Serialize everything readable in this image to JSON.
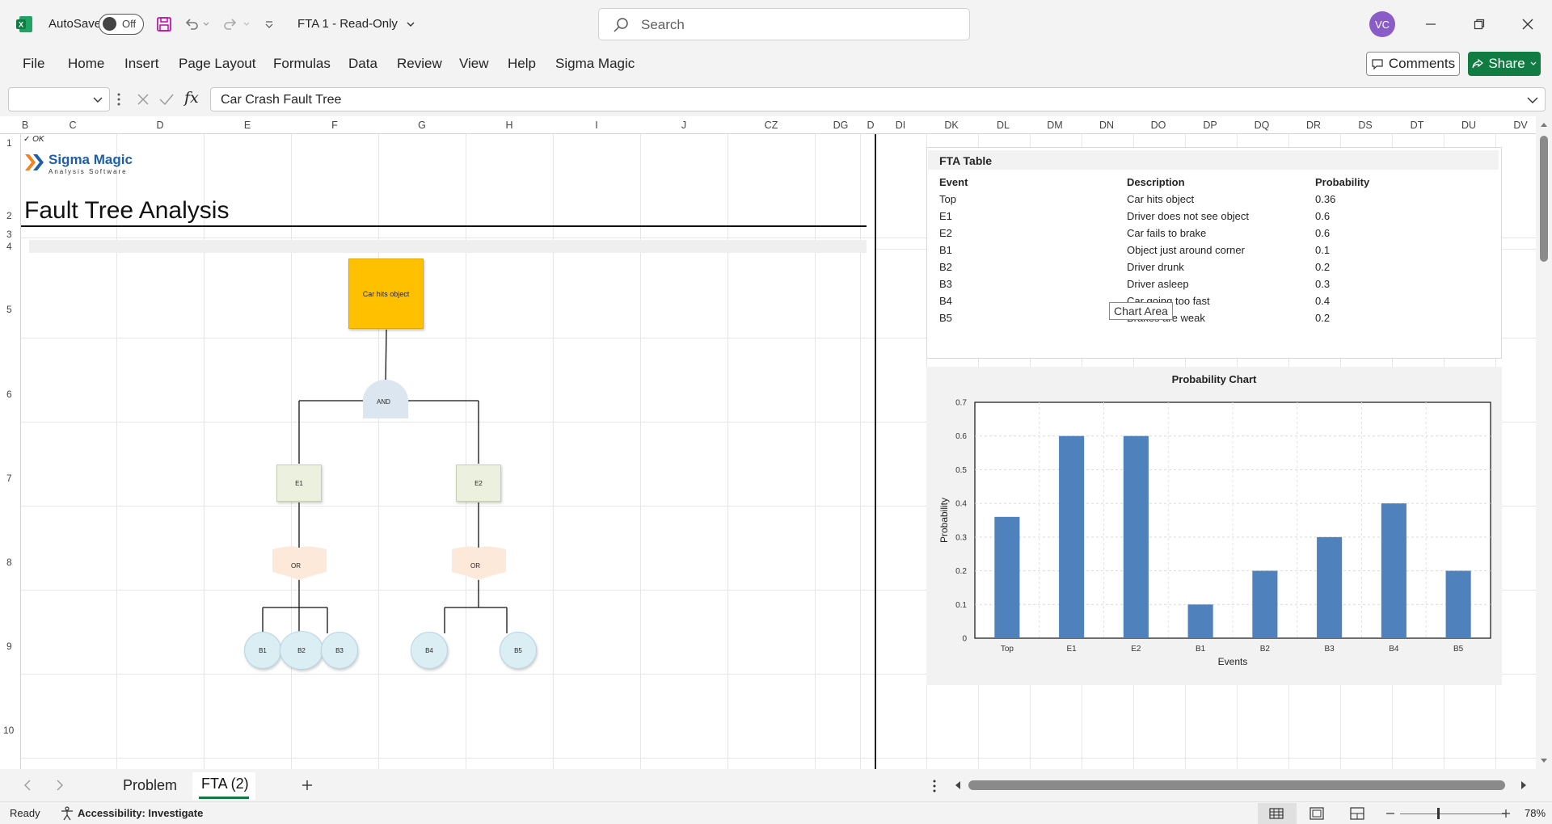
{
  "titlebar": {
    "autosave_label": "AutoSave",
    "autosave_state": "Off",
    "doc_title": "FTA 1  -  Read-Only",
    "search_placeholder": "Search",
    "avatar_initials": "VC"
  },
  "ribbon": {
    "tabs": [
      "File",
      "Home",
      "Insert",
      "Page Layout",
      "Formulas",
      "Data",
      "Review",
      "View",
      "Help",
      "Sigma Magic"
    ],
    "comments_label": "Comments",
    "share_label": "Share"
  },
  "formula_bar": {
    "name_box": "",
    "fx_label": "fx",
    "formula": "Car Crash Fault Tree"
  },
  "columns_left": [
    "B",
    "C",
    "D",
    "E",
    "F",
    "G",
    "H",
    "I",
    "J",
    "CZ",
    "DG",
    "D"
  ],
  "columns_right": [
    "DI",
    "DK",
    "DL",
    "DM",
    "DN",
    "DO",
    "DP",
    "DQ",
    "DR",
    "DS",
    "DT",
    "DU",
    "DV"
  ],
  "rows": [
    "1",
    "2",
    "3",
    "4",
    "5",
    "6",
    "7",
    "8",
    "9",
    "10"
  ],
  "sheet": {
    "cell_a1": "✓ OK",
    "brand_name": "Sigma Magic",
    "brand_sub": "Analysis Software",
    "title": "Fault Tree Analysis"
  },
  "fault_tree": {
    "top": "Car hits object",
    "gate_top": "AND",
    "e1": "E1",
    "e2": "E2",
    "gate_e1": "OR",
    "gate_e2": "OR",
    "b1": "B1",
    "b2": "B2",
    "b3": "B3",
    "b4": "B4",
    "b5": "B5",
    "colors": {
      "top": "#ffc000",
      "gate_and": "#dce6f1",
      "event": "#ebf1de",
      "gate_or": "#fde9d9",
      "basic": "#dbeef4"
    }
  },
  "fta_table": {
    "title": "FTA Table",
    "headers": [
      "Event",
      "Description",
      "Probability"
    ],
    "rows": [
      [
        "Top",
        "Car hits object",
        "0.36"
      ],
      [
        "E1",
        "Driver does not see object",
        "0.6"
      ],
      [
        "E2",
        "Car fails to brake",
        "0.6"
      ],
      [
        "B1",
        "Object just around corner",
        "0.1"
      ],
      [
        "B2",
        "Driver drunk",
        "0.2"
      ],
      [
        "B3",
        "Driver asleep",
        "0.3"
      ],
      [
        "B4",
        "Car going too fast",
        "0.4"
      ],
      [
        "B5",
        "Brakes are weak",
        "0.2"
      ]
    ]
  },
  "tooltip": "Chart Area",
  "chart_data": {
    "type": "bar",
    "title": "Probability Chart",
    "xlabel": "Events",
    "ylabel": "Probability",
    "categories": [
      "Top",
      "E1",
      "E2",
      "B1",
      "B2",
      "B3",
      "B4",
      "B5"
    ],
    "values": [
      0.36,
      0.6,
      0.6,
      0.1,
      0.2,
      0.3,
      0.4,
      0.2
    ],
    "ylim": [
      0,
      0.7
    ],
    "yticks": [
      "0",
      "0.1",
      "0.2",
      "0.3",
      "0.4",
      "0.5",
      "0.6",
      "0.7"
    ],
    "bar_color": "#4f81bd",
    "grid": true
  },
  "sheet_tabs": [
    "Problem",
    "FTA (2)"
  ],
  "active_tab": "FTA (2)",
  "status": {
    "ready": "Ready",
    "accessibility": "Accessibility: Investigate",
    "zoom": "78%"
  },
  "accent_color": "#107c41"
}
